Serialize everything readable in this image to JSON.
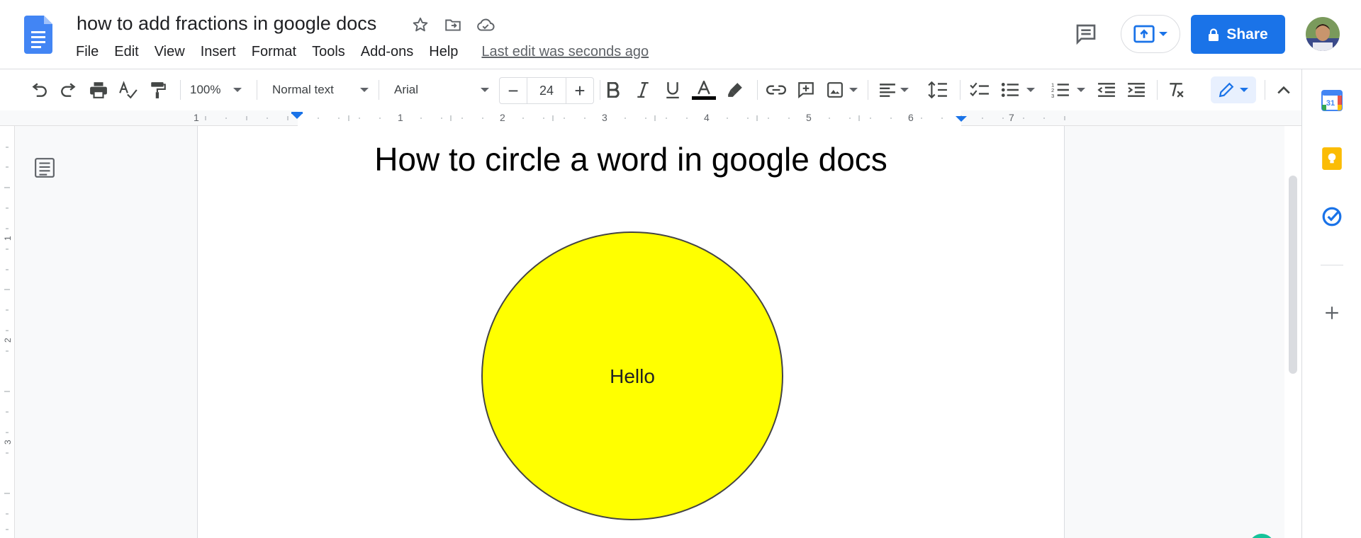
{
  "header": {
    "doc_title": "how to add fractions in google docs",
    "menu": [
      "File",
      "Edit",
      "View",
      "Insert",
      "Format",
      "Tools",
      "Add-ons",
      "Help"
    ],
    "last_edit": "Last edit was seconds ago",
    "share_label": "Share"
  },
  "toolbar": {
    "zoom": "100%",
    "style": "Normal text",
    "font": "Arial",
    "font_size": "24",
    "minus": "−",
    "plus": "+"
  },
  "ruler": {
    "labels": [
      "1",
      "1",
      "2",
      "3",
      "4",
      "5",
      "6",
      "7"
    ]
  },
  "document": {
    "heading": "How to circle a word in google docs",
    "circle_text": "Hello",
    "circle_fill": "#ffff00"
  },
  "side_panel": {
    "calendar_day": "31"
  },
  "colors": {
    "accent": "#1a73e8",
    "text_color_bar": "#000000"
  }
}
